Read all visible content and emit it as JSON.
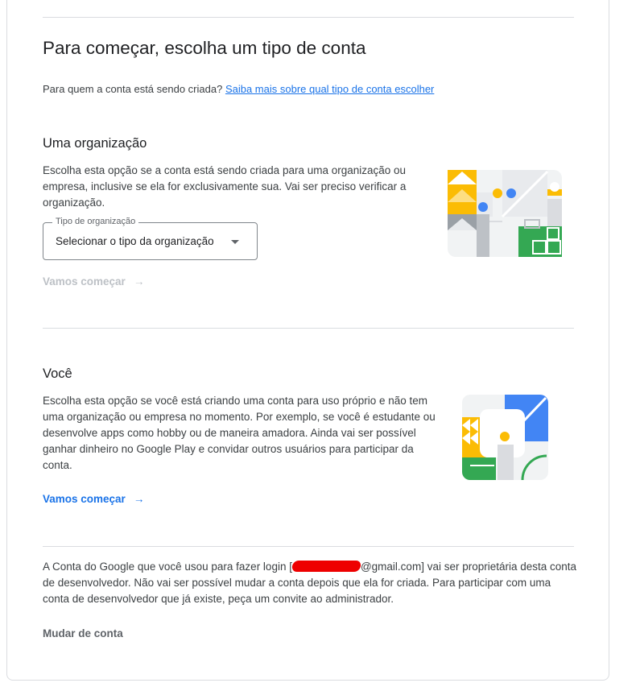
{
  "page": {
    "title": "Para começar, escolha um tipo de conta",
    "subtitle_text": "Para quem a conta está sendo criada?",
    "subtitle_link": "Saiba mais sobre qual tipo de conta escolher"
  },
  "organization": {
    "heading": "Uma organização",
    "description": "Escolha esta opção se a conta está sendo criada para uma organização ou empresa, inclusive se ela for exclusivamente sua. Vai ser preciso verificar a organização.",
    "select_label": "Tipo de organização",
    "select_value": "Selecionar o tipo da organização",
    "action_label": "Vamos começar",
    "illustration_icon": "organization-illustration"
  },
  "personal": {
    "heading": "Você",
    "description": "Escolha esta opção se você está criando uma conta para uso próprio e não tem uma organização ou empresa no momento. Por exemplo, se você é estudante ou desenvolve apps como hobby ou de maneira amadora. Ainda vai ser possível ganhar dinheiro no Google Play e convidar outros usuários para participar da conta.",
    "action_label": "Vamos começar",
    "illustration_icon": "personal-illustration"
  },
  "footer": {
    "text_before": "A Conta do Google que você usou para fazer login [",
    "email_suffix": "@gmail.com",
    "text_after": "] vai ser proprietária desta conta de desenvolvedor. Não vai ser possível mudar a conta depois que ela for criada. Para participar com uma conta de desenvolvedor que já existe, peça um convite ao administrador.",
    "switch_account": "Mudar de conta"
  },
  "colors": {
    "link": "#1a73e8",
    "disabled": "#bdc1c6",
    "yellow": "#fbbc04",
    "blue": "#4285f4",
    "green": "#34a853",
    "grey": "#dadce0"
  },
  "icons": {
    "arrow": "arrow-right-icon",
    "caret": "caret-down-icon"
  }
}
